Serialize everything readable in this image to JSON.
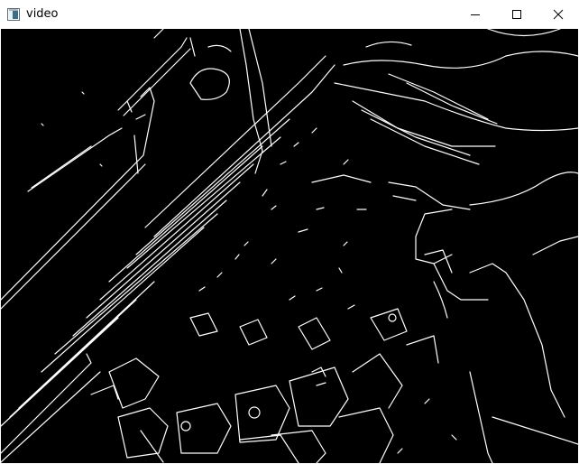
{
  "window": {
    "title": "video",
    "icon": "app-window-icon",
    "controls": {
      "minimize_icon": "minimize-icon",
      "maximize_icon": "maximize-icon",
      "close_icon": "close-icon"
    }
  },
  "video": {
    "content": "edge-detection-keyboard-frame",
    "background_color": "#000000",
    "edge_color": "#ffffff"
  }
}
